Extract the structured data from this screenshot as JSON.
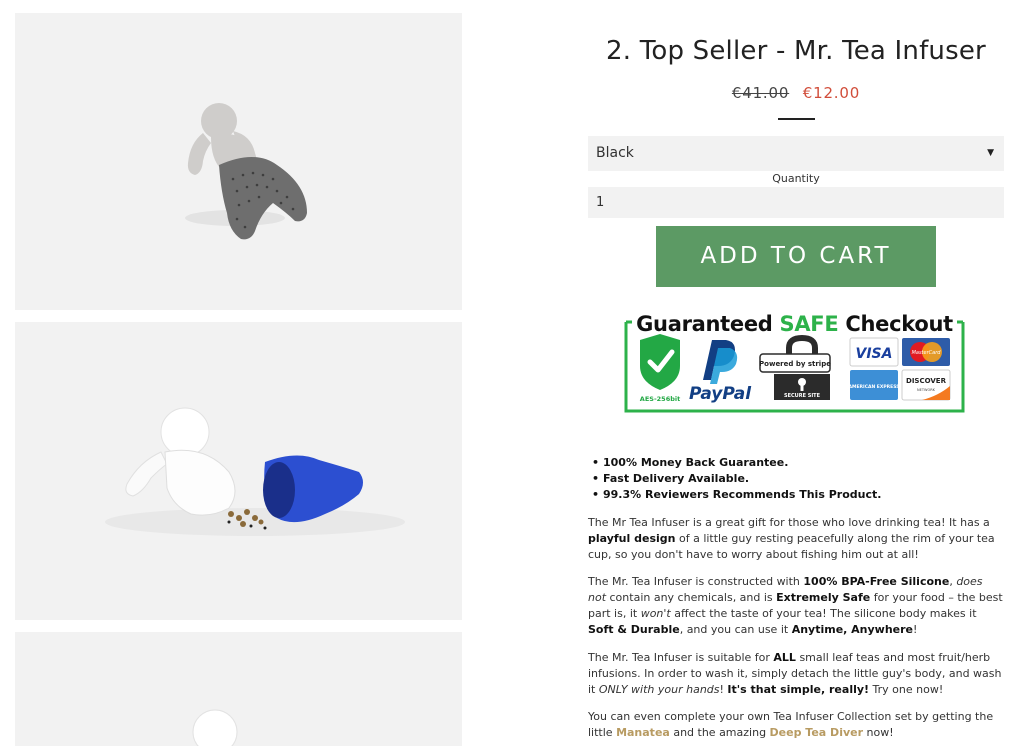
{
  "product": {
    "title": "2. Top Seller - Mr. Tea Infuser",
    "old_price": "€41.00",
    "new_price": "€12.00",
    "variant_selected": "Black",
    "quantity_label": "Quantity",
    "quantity_value": "1",
    "add_to_cart": "ADD TO CART"
  },
  "badge": {
    "title_part1": "Guaranteed ",
    "title_safe": "SAFE",
    "title_part2": " Checkout",
    "shield_text": "AES-256bit",
    "paypal": "PayPal",
    "stripe": "Powered by stripe",
    "secure": "SECURE SITE",
    "visa": "VISA",
    "mastercard": "MasterCard",
    "amex": "AMERICAN EXPRESS",
    "discover": "DISCOVER",
    "discover_sub": "NETWORK"
  },
  "bullets": [
    "100% Money Back Guarantee.",
    "Fast Delivery Available.",
    "99.3% Reviewers Recommends This Product."
  ],
  "desc": {
    "p1_a": "The Mr Tea Infuser is a great gift for those who love drinking tea! It has a ",
    "p1_b": "playful design",
    "p1_c": " of a little guy resting peacefully along the rim of your tea cup, so you don't have to worry about fishing him out at all!",
    "p2_a": "The Mr. Tea Infuser is constructed with ",
    "p2_b": "100% BPA-Free Silicone",
    "p2_c": ", ",
    "p2_d": "does not",
    "p2_e": " contain any chemicals, and is ",
    "p2_f": "Extremely Safe",
    "p2_g": " for your food – the best part is, it ",
    "p2_h": "won't",
    "p2_i": " affect the taste of your tea! The silicone body makes it ",
    "p2_j": "Soft & Durable",
    "p2_k": ", and you can use it ",
    "p2_l": "Anytime, Anywhere",
    "p2_m": "!",
    "p3_a": "The Mr. Tea Infuser is suitable for ",
    "p3_b": "ALL",
    "p3_c": " small leaf teas and most fruit/herb infusions. In order to wash it, simply detach the little guy's body, and wash it ",
    "p3_d": "ONLY with your hands",
    "p3_e": "! ",
    "p3_f": "It's that simple, really!",
    "p3_g": " Try one now!",
    "p4_a": "You can even complete your own Tea Infuser Collection set by getting the little ",
    "p4_link1": "Manatea",
    "p4_b": " and the amazing ",
    "p4_link2": "Deep Tea Diver",
    "p4_c": " now!"
  }
}
